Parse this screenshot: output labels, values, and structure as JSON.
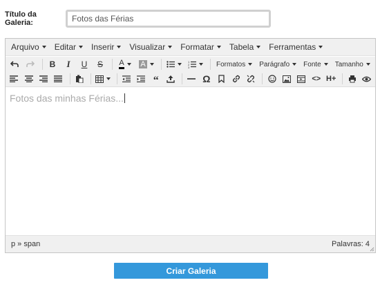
{
  "form": {
    "title_label": "Título da Galeria:",
    "title_value": "Fotos das Férias"
  },
  "editor": {
    "menus": [
      "Arquivo",
      "Editar",
      "Inserir",
      "Visualizar",
      "Formatar",
      "Tabela",
      "Ferramentas"
    ],
    "dropdowns": {
      "formats": "Formatos",
      "paragraph": "Parágrafo",
      "font": "Fonte",
      "size": "Tamanho"
    },
    "content": "Fotos das minhas Férias...",
    "path": "p » span",
    "word_count": "Palavras: 4"
  },
  "submit_label": "Criar Galeria",
  "colors": {
    "accent": "#3498db",
    "toolbar_bg": "#f0f0f0",
    "placeholder_text": "#aaaaaa"
  }
}
